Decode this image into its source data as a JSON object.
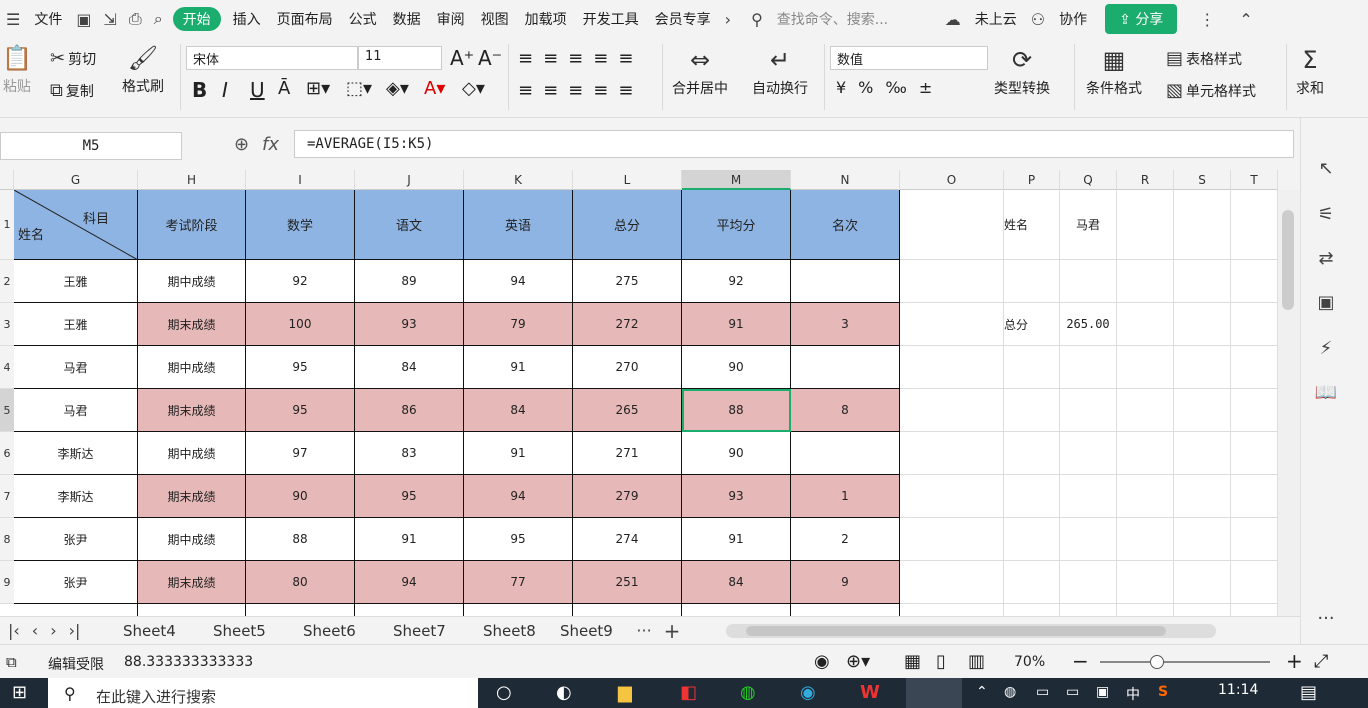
{
  "menubar": {
    "file": "文件",
    "items": [
      "开始",
      "插入",
      "页面布局",
      "公式",
      "数据",
      "审阅",
      "视图",
      "加载项",
      "开发工具",
      "会员专享"
    ],
    "search": "查找命令、搜索...",
    "cloud": "未上云",
    "collab": "协作",
    "share": "分享"
  },
  "ribbon": {
    "paste": "粘贴",
    "cut": "剪切",
    "copy": "复制",
    "format_painter": "格式刷",
    "font": "宋体",
    "size": "11",
    "merge": "合并居中",
    "wrap": "自动换行",
    "numfmt": "数值",
    "convert": "类型转换",
    "condfmt": "条件格式",
    "tablestyle": "表格样式",
    "cellstyle": "单元格样式",
    "sum": "求和",
    "bold": "B",
    "italic": "I",
    "underline": "U"
  },
  "formula": {
    "namebox": "M5",
    "fx": "fx",
    "formula": "=AVERAGE(I5:K5)"
  },
  "columns": [
    "G",
    "H",
    "I",
    "J",
    "K",
    "L",
    "M",
    "N",
    "O",
    "P",
    "Q",
    "R",
    "S",
    "T"
  ],
  "rownums": [
    "1",
    "2",
    "3",
    "4",
    "5",
    "6",
    "7",
    "8",
    "9"
  ],
  "header": {
    "subject": "科目",
    "name": "姓名",
    "stage": "考试阶段",
    "math": "数学",
    "chinese": "语文",
    "english": "英语",
    "total": "总分",
    "avg": "平均分",
    "rank": "名次"
  },
  "rows": [
    [
      "王雅",
      "期中成绩",
      "92",
      "89",
      "94",
      "275",
      "92",
      ""
    ],
    [
      "王雅",
      "期末成绩",
      "100",
      "93",
      "79",
      "272",
      "91",
      "3"
    ],
    [
      "马君",
      "期中成绩",
      "95",
      "84",
      "91",
      "270",
      "90",
      ""
    ],
    [
      "马君",
      "期末成绩",
      "95",
      "86",
      "84",
      "265",
      "88",
      "8"
    ],
    [
      "李斯达",
      "期中成绩",
      "97",
      "83",
      "91",
      "271",
      "90",
      ""
    ],
    [
      "李斯达",
      "期末成绩",
      "90",
      "95",
      "94",
      "279",
      "93",
      "1"
    ],
    [
      "张尹",
      "期中成绩",
      "88",
      "91",
      "95",
      "274",
      "91",
      "2"
    ],
    [
      "张尹",
      "期末成绩",
      "80",
      "94",
      "77",
      "251",
      "84",
      "9"
    ]
  ],
  "side": {
    "name_label": "姓名",
    "name_value": "马君",
    "total_label": "总分",
    "total_value": "265.00"
  },
  "sheets": [
    "Sheet4",
    "Sheet5",
    "Sheet6",
    "Sheet7",
    "Sheet8",
    "Sheet9"
  ],
  "status": {
    "mode": "编辑受限",
    "value": "88.333333333333",
    "zoom": "70%"
  },
  "taskbar": {
    "search": "在此键入进行搜索",
    "time": "11:14",
    "ime": "中"
  }
}
